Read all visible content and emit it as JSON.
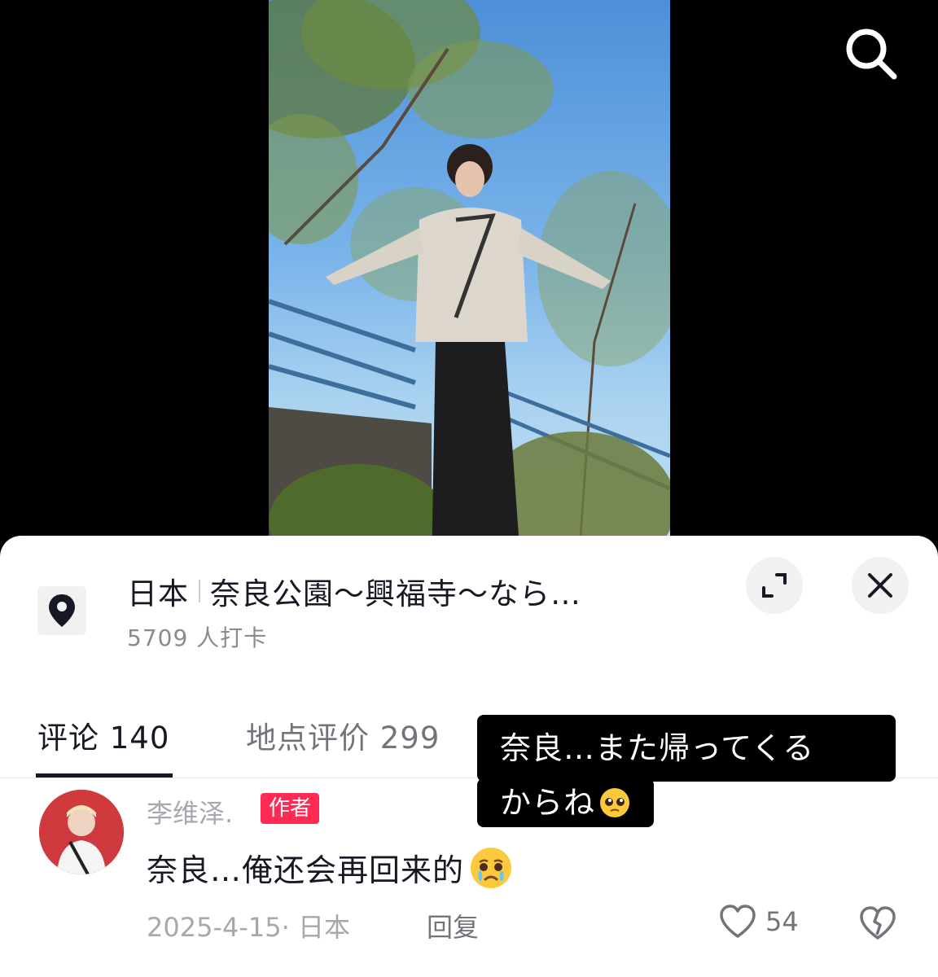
{
  "location": {
    "country": "日本",
    "place": "奈良公園～興福寺～なら…",
    "checkins": "5709 人打卡"
  },
  "tabs": [
    {
      "label": "评论 140",
      "active": true
    },
    {
      "label": "地点评价 299",
      "active": false
    }
  ],
  "comment": {
    "username": "李维泽.",
    "badge": "作者",
    "text": "奈良…俺还会再回来的",
    "date_location": "2025-4-15· 日本",
    "reply_label": "回复",
    "likes": "54"
  },
  "caption": {
    "line1": "奈良…また帰ってくる",
    "line2": "からね"
  },
  "icons": [
    "search-icon",
    "location-pin-icon",
    "expand-icon",
    "close-icon",
    "heart-icon",
    "broken-heart-icon",
    "pleading-face-emoji",
    "crying-face-emoji"
  ],
  "colors": {
    "badge": "#fe2c55",
    "text_primary": "#161823",
    "text_secondary": "#a7a8ad"
  }
}
